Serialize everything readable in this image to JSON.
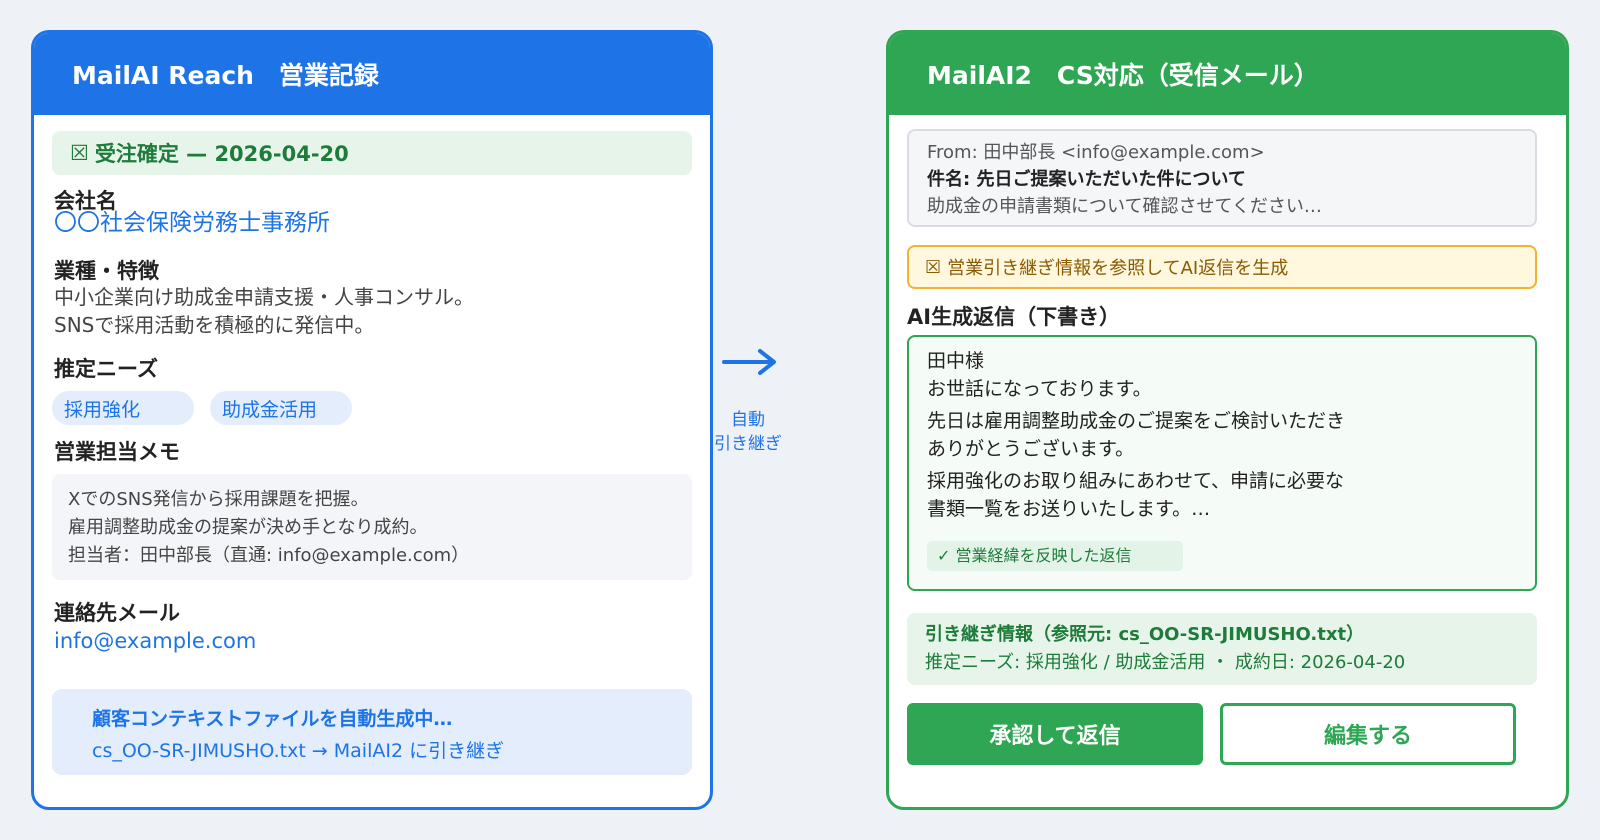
{
  "left": {
    "header_title": "MailAI Reach　営業記録",
    "status_icon": "☒",
    "status_text": "受注確定 — 2026-04-20",
    "company_label": "会社名",
    "company_name": "〇〇社会保険労務士事務所",
    "industry_label": "業種・特徴",
    "industry_line1": "中小企業向け助成金申請支援・人事コンサル。",
    "industry_line2": "SNSで採用活動を積極的に発信中。",
    "needs_label": "推定ニーズ",
    "needs": [
      "採用強化",
      "助成金活用"
    ],
    "memo_label": "営業担当メモ",
    "memo_lines": [
      "XでのSNS発信から採用課題を把握。",
      "雇用調整助成金の提案が決め手となり成約。",
      "担当者：田中部長（直通: info@example.com）"
    ],
    "contact_label": "連絡先メール",
    "contact_email": "info@example.com",
    "gen_title": "顧客コンテキストファイルを自動生成中…",
    "gen_detail": "cs_OO-SR-JIMUSHO.txt → MailAI2 に引き継ぎ"
  },
  "arrow": {
    "line1": "自動",
    "line2": "引き継ぎ",
    "color": "#1e74e6"
  },
  "right": {
    "header_title": "MailAI2　CS対応（受信メール）",
    "mail_from": "From: 田中部長 <info@example.com>",
    "mail_subject": "件名: 先日ご提案いただいた件について",
    "mail_preview": "助成金の申請書類について確認させてください…",
    "ai_icon": "☒",
    "ai_text": "営業引き継ぎ情報を参照してAI返信を生成",
    "draft_title": "AI生成返信（下書き）",
    "draft_lines": [
      "田中様",
      "お世話になっております。",
      "先日は雇用調整助成金のご提案をご検討いただき",
      "ありがとうございます。",
      "採用強化のお取り組みにあわせて、申請に必要な",
      "書類一覧をお送りいたします。…"
    ],
    "draft_badge": "✓ 営業経緯を反映した返信",
    "handoff_title": "引き継ぎ情報（参照元: cs_OO-SR-JIMUSHO.txt）",
    "handoff_detail": "推定ニーズ: 採用強化 / 助成金活用 ・ 成約日: 2026-04-20",
    "approve_label": "承認して返信",
    "edit_label": "編集する"
  },
  "colors": {
    "blue": "#1e74e6",
    "green": "#2fa653",
    "amber": "#f2b233"
  }
}
